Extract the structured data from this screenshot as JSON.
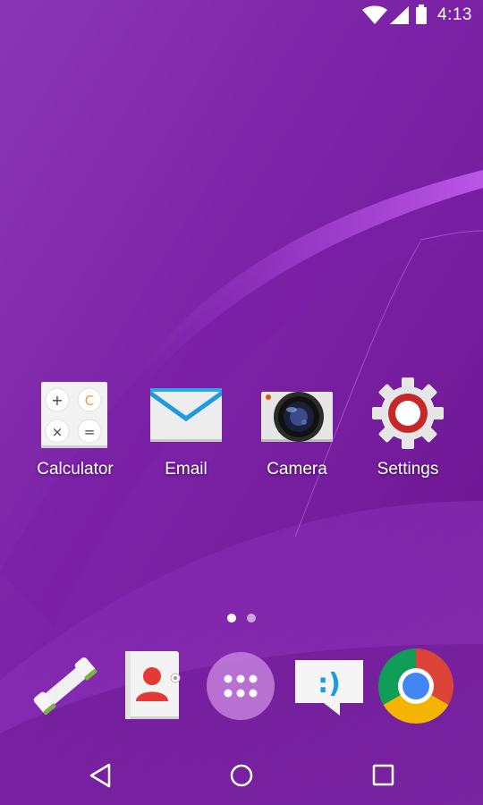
{
  "status_bar": {
    "time": "4:13",
    "icons": [
      "wifi-icon",
      "signal-icon",
      "battery-icon"
    ]
  },
  "home": {
    "apps": [
      {
        "label": "Calculator",
        "icon": "calculator-icon",
        "calc_keys": [
          "+",
          "C",
          "×",
          "="
        ]
      },
      {
        "label": "Email",
        "icon": "email-icon"
      },
      {
        "label": "Camera",
        "icon": "camera-icon"
      },
      {
        "label": "Settings",
        "icon": "settings-gear-icon"
      }
    ],
    "pages": {
      "count": 2,
      "current": 1
    }
  },
  "dock": {
    "items": [
      {
        "name": "phone",
        "icon": "phone-icon"
      },
      {
        "name": "contacts",
        "icon": "contacts-icon"
      },
      {
        "name": "app-drawer",
        "icon": "app-drawer-icon"
      },
      {
        "name": "messaging",
        "icon": "messaging-icon",
        "glyph": ":)"
      },
      {
        "name": "chrome",
        "icon": "chrome-icon"
      }
    ]
  },
  "navigation": {
    "buttons": [
      "back-icon",
      "home-icon",
      "recents-icon"
    ]
  },
  "colors": {
    "wallpaper": "#7b1fa2",
    "wallpaper_light": "#a24ad0",
    "dot_active": "#ffffff",
    "dot_inactive": "#c9a8d8",
    "settings_red": "#c62828",
    "chrome_red": "#db4437",
    "chrome_yellow": "#f4b400",
    "chrome_green": "#0f9d58",
    "chrome_blue": "#4285f4"
  }
}
